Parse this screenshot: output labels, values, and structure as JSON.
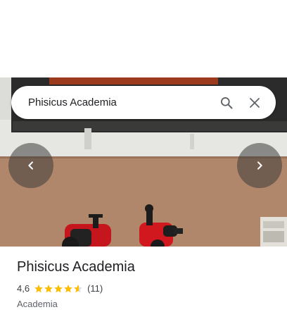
{
  "search": {
    "query": "Phisicus Academia"
  },
  "place": {
    "name": "Phisicus Academia",
    "rating_text": "4,6",
    "rating_value": 4.6,
    "reviews_text": "(11)",
    "category": "Academia"
  },
  "icons": {
    "search": "search-icon",
    "close": "close-icon",
    "prev": "chevron-left-icon",
    "next": "chevron-right-icon",
    "star": "star-icon"
  },
  "colors": {
    "star": "#fbbc04",
    "star_empty": "#dadce0",
    "title": "#202124",
    "secondary": "#5f6368"
  }
}
